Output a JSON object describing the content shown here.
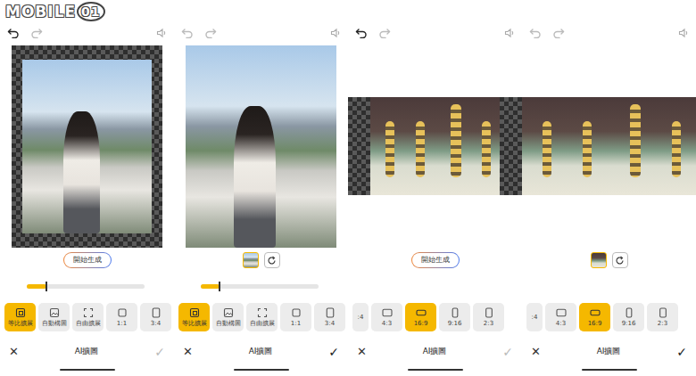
{
  "watermark": {
    "brand": "MOBILE",
    "suffix": "01"
  },
  "panels": [
    {
      "image_kind": "portrait-expand",
      "undo_enabled": true,
      "redo_enabled": false,
      "action": {
        "kind": "generate",
        "label": "開始生成"
      },
      "slider": {
        "level": 0.17
      },
      "chips": [
        {
          "kind": "proportional",
          "label": "等比擴展",
          "selected": true
        },
        {
          "kind": "auto",
          "label": "自動構圖",
          "selected": false
        },
        {
          "kind": "free",
          "label": "自由擴展",
          "selected": false
        },
        {
          "kind": "ratio",
          "label": "1:1",
          "selected": false
        },
        {
          "kind": "ratio",
          "label": "3:4",
          "selected": false
        }
      ],
      "footer": {
        "close": "✕",
        "title": "AI擴圖",
        "confirm": "✓",
        "confirm_enabled": false
      }
    },
    {
      "image_kind": "portrait-filled",
      "undo_enabled": false,
      "redo_enabled": false,
      "action": {
        "kind": "result"
      },
      "slider": {
        "level": 0.16
      },
      "chips": [
        {
          "kind": "proportional",
          "label": "等比擴展",
          "selected": true
        },
        {
          "kind": "auto",
          "label": "自動構圖",
          "selected": false
        },
        {
          "kind": "free",
          "label": "自由擴展",
          "selected": false
        },
        {
          "kind": "ratio",
          "label": "1:1",
          "selected": false
        },
        {
          "kind": "ratio",
          "label": "3:4",
          "selected": false
        }
      ],
      "footer": {
        "close": "✕",
        "title": "AI擴圖",
        "confirm": "✓",
        "confirm_enabled": true
      }
    },
    {
      "image_kind": "wide-expand",
      "undo_enabled": true,
      "redo_enabled": false,
      "action": {
        "kind": "generate",
        "label": "開始生成"
      },
      "chips": [
        {
          "kind": "partial",
          "label": ":4",
          "selected": false
        },
        {
          "kind": "ratio",
          "label": "4:3",
          "selected": false
        },
        {
          "kind": "ratio",
          "label": "16:9",
          "selected": true
        },
        {
          "kind": "ratio",
          "label": "9:16",
          "selected": false
        },
        {
          "kind": "ratio",
          "label": "2:3",
          "selected": false
        }
      ],
      "footer": {
        "close": "✕",
        "title": "AI擴圖",
        "confirm": "✓",
        "confirm_enabled": false
      }
    },
    {
      "image_kind": "wide-filled",
      "undo_enabled": false,
      "redo_enabled": false,
      "action": {
        "kind": "result"
      },
      "chips": [
        {
          "kind": "partial",
          "label": ":4",
          "selected": false
        },
        {
          "kind": "ratio",
          "label": "4:3",
          "selected": false
        },
        {
          "kind": "ratio",
          "label": "16:9",
          "selected": true
        },
        {
          "kind": "ratio",
          "label": "9:16",
          "selected": false
        },
        {
          "kind": "ratio",
          "label": "2:3",
          "selected": false
        }
      ],
      "footer": {
        "close": "✕",
        "title": "AI擴圖",
        "confirm": "✓",
        "confirm_enabled": true
      }
    }
  ]
}
